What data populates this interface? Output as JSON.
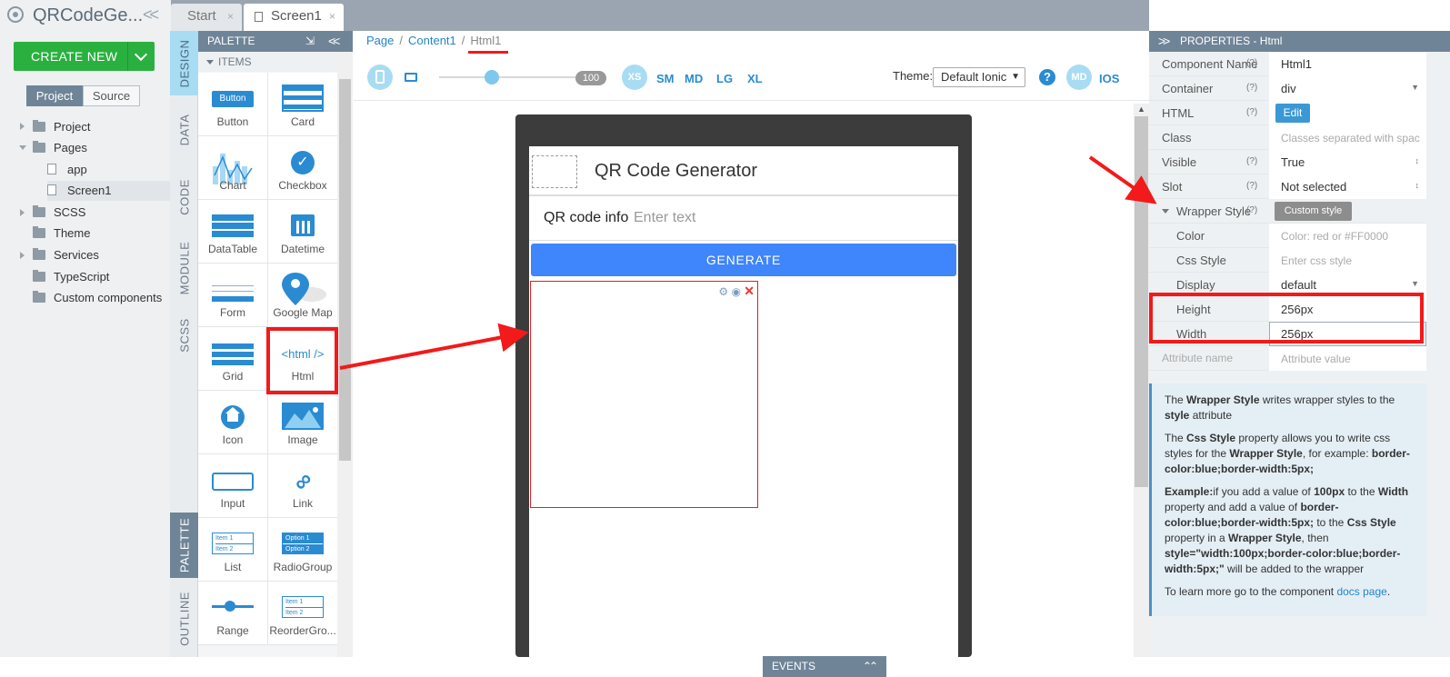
{
  "app": {
    "title": "QRCodeGe...",
    "create_new": "CREATE NEW"
  },
  "project_tabs": {
    "project": "Project",
    "source": "Source"
  },
  "tree": [
    "Project",
    "Pages",
    "app",
    "Screen1",
    "SCSS",
    "Theme",
    "Services",
    "TypeScript",
    "Custom components"
  ],
  "doc_tabs": {
    "start": "Start",
    "screen1": "Screen1",
    "close": "×"
  },
  "vnav": {
    "design": "DESIGN",
    "data": "DATA",
    "code": "CODE",
    "module": "MODULE",
    "scss": "SCSS",
    "palette": "PALETTE",
    "outline": "OUTLINE"
  },
  "palette": {
    "title": "PALETTE",
    "items_label": "ITEMS",
    "items": [
      "Button",
      "Card",
      "Chart",
      "Checkbox",
      "DataTable",
      "Datetime",
      "Form",
      "Google Map",
      "Grid",
      "Html",
      "Icon",
      "Image",
      "Input",
      "Link",
      "List",
      "RadioGroup",
      "Range",
      "ReorderGro..."
    ],
    "button_icon_text": "Button",
    "html_icon_text": "<html />",
    "list_icon_item1": "Item 1",
    "list_icon_item2": "Item 2",
    "radio_icon_opt1": "Option 1",
    "radio_icon_opt2": "Option 2",
    "reorder_item1": "Item 1",
    "reorder_item2": "Item 2"
  },
  "breadcrumb": {
    "page": "Page",
    "content": "Content1",
    "current": "Html1",
    "sep": "/"
  },
  "toolbar": {
    "zoom": "100",
    "breakpoints": {
      "xs": "XS",
      "sm": "SM",
      "md": "MD",
      "lg": "LG",
      "xl": "XL"
    },
    "theme_label": "Theme:",
    "theme_value": "Default Ionic",
    "help": "?",
    "md": "MD",
    "ios": "IOS"
  },
  "device": {
    "app_title": "QR Code Generator",
    "input_label": "QR code info",
    "input_placeholder": "Enter text",
    "generate": "GENERATE",
    "events": "EVENTS"
  },
  "properties": {
    "title": "PROPERTIES - Html",
    "rows": [
      {
        "key": "Component Name",
        "q": "(?)",
        "value": "Html1"
      },
      {
        "key": "Container",
        "q": "(?)",
        "value": "div"
      },
      {
        "key": "HTML",
        "q": "(?)",
        "value": "Edit"
      },
      {
        "key": "Class",
        "q": "",
        "value": "Classes separated with spac"
      },
      {
        "key": "Visible",
        "q": "(?)",
        "value": "True"
      },
      {
        "key": "Slot",
        "q": "(?)",
        "value": "Not selected"
      },
      {
        "key": "Wrapper Style",
        "q": "(?)",
        "value": "Custom style"
      },
      {
        "key": "Color",
        "q": "",
        "value": "Color: red or #FF0000"
      },
      {
        "key": "Css Style",
        "q": "",
        "value": "Enter css style"
      },
      {
        "key": "Display",
        "q": "",
        "value": "default"
      },
      {
        "key": "Height",
        "q": "",
        "value": "256px"
      },
      {
        "key": "Width",
        "q": "",
        "value": "256px"
      },
      {
        "key": "Attribute name",
        "q": "",
        "value": "Attribute value"
      }
    ]
  },
  "info": {
    "p1_a": "The ",
    "p1_b": "Wrapper Style",
    "p1_c": " writes wrapper styles to the ",
    "p1_d": "style",
    "p1_e": " attribute",
    "p2_a": "The ",
    "p2_b": "Css Style",
    "p2_c": " property allows you to write css styles for the ",
    "p2_d": "Wrapper Style",
    "p2_e": ", for example: ",
    "p2_f": "border-color:blue;border-width:5px;",
    "p3_a": "Example:",
    "p3_b": "if you add a value of ",
    "p3_c": "100px",
    "p3_d": " to the ",
    "p3_e": "Width",
    "p3_f": " property and add a value of ",
    "p3_g": "border-color:blue;border-width:5px;",
    "p3_h": " to the ",
    "p3_i": "Css Style",
    "p3_j": " property in a ",
    "p3_k": "Wrapper Style",
    "p3_l": ", then ",
    "p3_m": "style=\"width:100px;border-color:blue;border-width:5px;\"",
    "p3_n": " will be added to the wrapper",
    "p4_a": "To learn more go to the component ",
    "p4_link": "docs page",
    "p4_b": "."
  },
  "colors": {
    "accent": "#2a8bd2",
    "create": "#2ab03f",
    "header": "#6f8497",
    "annotation": "#f21a1a"
  }
}
